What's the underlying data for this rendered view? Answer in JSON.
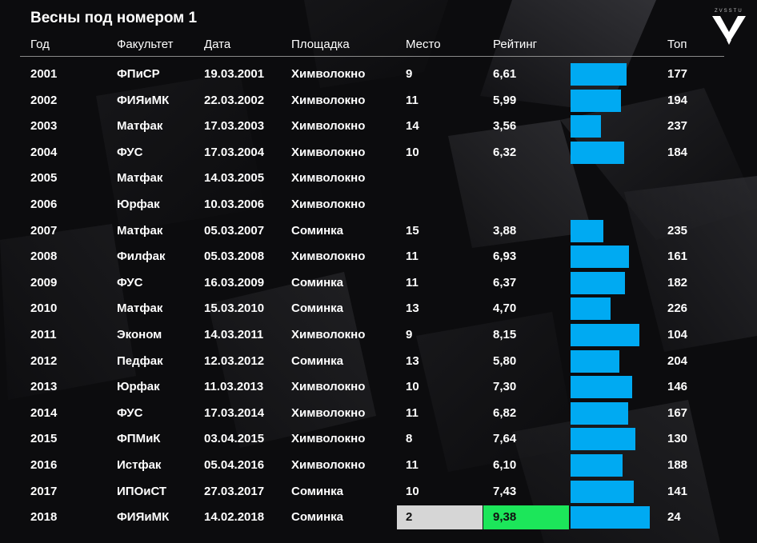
{
  "title": "Весны под номером 1",
  "logo_text": "ZVSSTU",
  "colors": {
    "bar": "#00aaf2",
    "highlight_place": "#d6d6d6",
    "highlight_rating": "#1ce65a",
    "background": "#0d0d0f"
  },
  "headers": {
    "year": "Год",
    "faculty": "Факультет",
    "date": "Дата",
    "venue": "Площадка",
    "place": "Место",
    "rating": "Рейтинг",
    "top": "Топ"
  },
  "chart_data": {
    "type": "table",
    "title": "Весны под номером 1",
    "columns": [
      "Год",
      "Факультет",
      "Дата",
      "Площадка",
      "Место",
      "Рейтинг",
      "Топ"
    ],
    "bar_column": "Рейтинг",
    "bar_max": 10,
    "rows": [
      {
        "year": "2001",
        "faculty": "ФПиСР",
        "date": "19.03.2001",
        "venue": "Химволокно",
        "place": "9",
        "rating": "6,61",
        "rating_value": 6.61,
        "top": "177"
      },
      {
        "year": "2002",
        "faculty": "ФИЯиМК",
        "date": "22.03.2002",
        "venue": "Химволокно",
        "place": "11",
        "rating": "5,99",
        "rating_value": 5.99,
        "top": "194"
      },
      {
        "year": "2003",
        "faculty": "Матфак",
        "date": "17.03.2003",
        "venue": "Химволокно",
        "place": "14",
        "rating": "3,56",
        "rating_value": 3.56,
        "top": "237"
      },
      {
        "year": "2004",
        "faculty": "ФУС",
        "date": "17.03.2004",
        "venue": "Химволокно",
        "place": "10",
        "rating": "6,32",
        "rating_value": 6.32,
        "top": "184"
      },
      {
        "year": "2005",
        "faculty": "Матфак",
        "date": "14.03.2005",
        "venue": "Химволокно",
        "place": "",
        "rating": "",
        "rating_value": null,
        "top": ""
      },
      {
        "year": "2006",
        "faculty": "Юрфак",
        "date": "10.03.2006",
        "venue": "Химволокно",
        "place": "",
        "rating": "",
        "rating_value": null,
        "top": ""
      },
      {
        "year": "2007",
        "faculty": "Матфак",
        "date": "05.03.2007",
        "venue": "Соминка",
        "place": "15",
        "rating": "3,88",
        "rating_value": 3.88,
        "top": "235"
      },
      {
        "year": "2008",
        "faculty": "Филфак",
        "date": "05.03.2008",
        "venue": "Химволокно",
        "place": "11",
        "rating": "6,93",
        "rating_value": 6.93,
        "top": "161"
      },
      {
        "year": "2009",
        "faculty": "ФУС",
        "date": "16.03.2009",
        "venue": "Соминка",
        "place": "11",
        "rating": "6,37",
        "rating_value": 6.37,
        "top": "182"
      },
      {
        "year": "2010",
        "faculty": "Матфак",
        "date": "15.03.2010",
        "venue": "Соминка",
        "place": "13",
        "rating": "4,70",
        "rating_value": 4.7,
        "top": "226"
      },
      {
        "year": "2011",
        "faculty": "Эконом",
        "date": "14.03.2011",
        "venue": "Химволокно",
        "place": "9",
        "rating": "8,15",
        "rating_value": 8.15,
        "top": "104"
      },
      {
        "year": "2012",
        "faculty": "Педфак",
        "date": "12.03.2012",
        "venue": "Соминка",
        "place": "13",
        "rating": "5,80",
        "rating_value": 5.8,
        "top": "204"
      },
      {
        "year": "2013",
        "faculty": "Юрфак",
        "date": "11.03.2013",
        "venue": "Химволокно",
        "place": "10",
        "rating": "7,30",
        "rating_value": 7.3,
        "top": "146"
      },
      {
        "year": "2014",
        "faculty": "ФУС",
        "date": "17.03.2014",
        "venue": "Химволокно",
        "place": "11",
        "rating": "6,82",
        "rating_value": 6.82,
        "top": "167"
      },
      {
        "year": "2015",
        "faculty": "ФПМиК",
        "date": "03.04.2015",
        "venue": "Химволокно",
        "place": "8",
        "rating": "7,64",
        "rating_value": 7.64,
        "top": "130"
      },
      {
        "year": "2016",
        "faculty": "Истфак",
        "date": "05.04.2016",
        "venue": "Химволокно",
        "place": "11",
        "rating": "6,10",
        "rating_value": 6.1,
        "top": "188"
      },
      {
        "year": "2017",
        "faculty": "ИПОиСТ",
        "date": "27.03.2017",
        "venue": "Соминка",
        "place": "10",
        "rating": "7,43",
        "rating_value": 7.43,
        "top": "141"
      },
      {
        "year": "2018",
        "faculty": "ФИЯиМК",
        "date": "14.02.2018",
        "venue": "Соминка",
        "place": "2",
        "rating": "9,38",
        "rating_value": 9.38,
        "top": "24",
        "highlight": true
      }
    ]
  }
}
